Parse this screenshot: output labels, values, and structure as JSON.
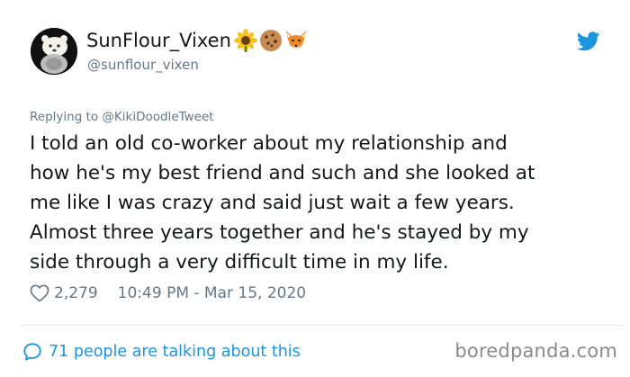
{
  "author": {
    "display_name": "SunFlour_Vixen",
    "username": "@sunflour_vixen",
    "emojis": [
      "sunflower-icon",
      "cookie-icon",
      "fox-icon"
    ]
  },
  "reply": {
    "prefix": "Replying to",
    "handle": "@KikiDoodleTweet"
  },
  "tweet": {
    "text": "I told an old co-worker about my relationship and\nhow he's my best friend and such and she looked at\nme like I was crazy and said just wait a few years.\nAlmost three years together and he's stayed by my\nside through a very difficult time in my life.",
    "likes": "2,279",
    "timestamp": "10:49 PM - Mar 15, 2020"
  },
  "footer": {
    "talking": "71 people are talking about this",
    "watermark": "boredpanda.com"
  },
  "colors": {
    "accent": "#1b95e0",
    "muted": "#657786",
    "text": "#14171a"
  }
}
